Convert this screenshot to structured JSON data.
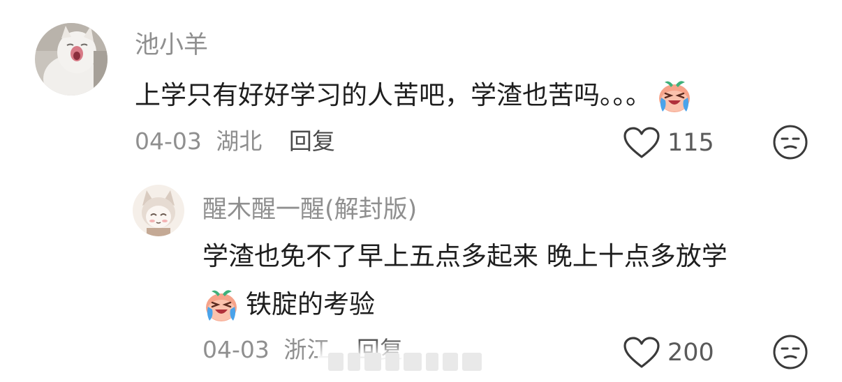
{
  "comment": {
    "username": "池小羊",
    "text": "上学只有好好学习的人苦吧，学渣也苦吗。。。",
    "emoji": "crying-laughing-peach-emoji",
    "date": "04-03",
    "location": "湖北",
    "reply_label": "回复",
    "likes": "115",
    "icons": {
      "like": "heart-icon",
      "dislike": "unamused-face-icon"
    }
  },
  "reply": {
    "username": "醒木醒一醒",
    "username_tag": "(解封版)",
    "text_line1": "学渣也免不了早上五点多起来 晚上十点多放学",
    "emoji": "crying-laughing-peach-emoji",
    "text_line2": "铁腚的考验",
    "date": "04-03",
    "location": "浙江",
    "reply_label": "回复",
    "likes": "200",
    "icons": {
      "like": "heart-icon",
      "dislike": "unamused-face-icon"
    }
  },
  "colors": {
    "secondary_text": "#8f8f8f",
    "primary_text": "#1e1e1e",
    "icon_stroke": "#3a3a3a",
    "emoji_peach": "#f6a38a",
    "emoji_leaf": "#3fb07a",
    "emoji_tear": "#4aa3ea"
  }
}
